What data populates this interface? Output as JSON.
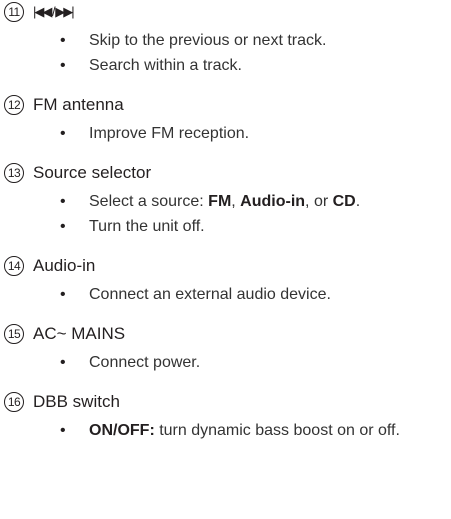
{
  "sections": [
    {
      "number": "11",
      "title": "|◀◀ / ▶▶|",
      "bullets": [
        "Skip to the previous or next track.",
        "Search within a track."
      ]
    },
    {
      "number": "12",
      "title": "FM antenna",
      "bullets": [
        "Improve FM reception."
      ]
    },
    {
      "number": "13",
      "title": "Source selector",
      "bullets": [
        {
          "prefix": "Select a source: ",
          "fm": "FM",
          "sep1": ", ",
          "audio_in": "Audio-in",
          "sep2": ", or  ",
          "cd": "CD",
          "suffix": "."
        },
        "Turn the unit off."
      ]
    },
    {
      "number": "14",
      "title": "Audio-in",
      "bullets": [
        "Connect an external audio device."
      ]
    },
    {
      "number": "15",
      "title": "AC~ MAINS",
      "bullets": [
        "Connect power."
      ]
    },
    {
      "number": "16",
      "title": "DBB switch",
      "bullets": [
        {
          "label": "ON/OFF:",
          "text": " turn dynamic bass boost on or off."
        }
      ]
    }
  ],
  "bullet_char": "•"
}
